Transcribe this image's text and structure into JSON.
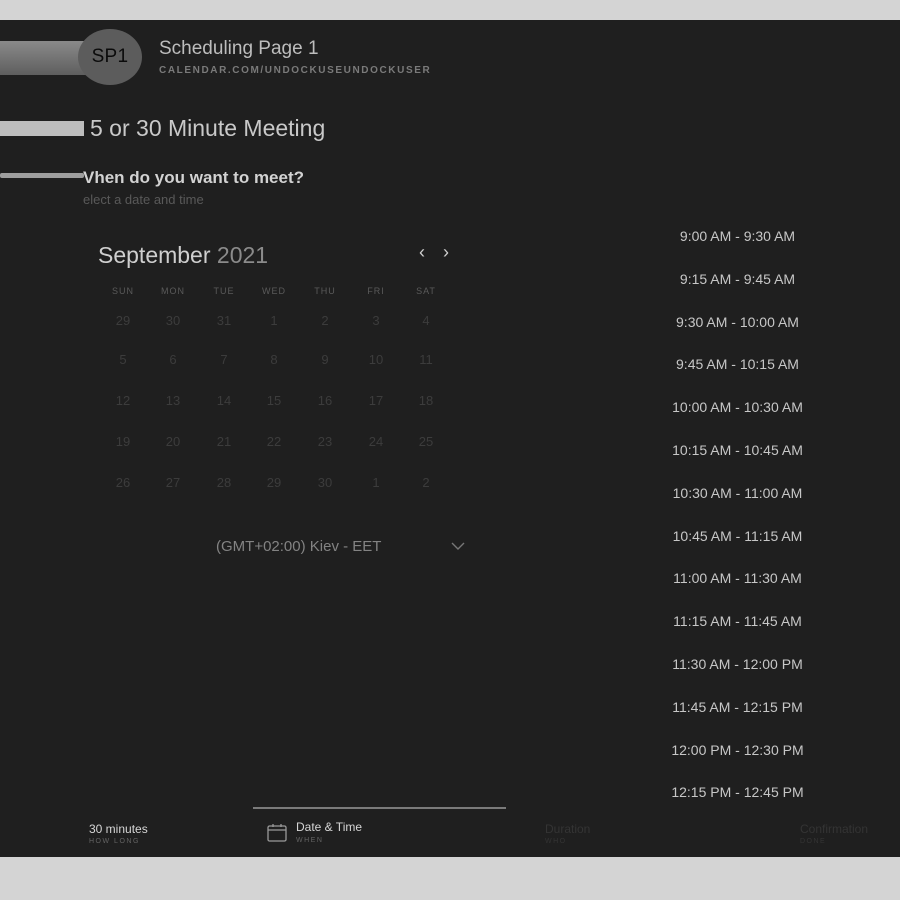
{
  "header": {
    "avatar_initials": "SP1",
    "page_name": "Scheduling Page 1",
    "page_url": "CALENDAR.COM/UNDOCKUSEUNDOCKUSER"
  },
  "meeting": {
    "title": "5 or 30 Minute Meeting",
    "question": "Vhen do you want to meet?",
    "subtitle": "elect a date and time"
  },
  "calendar": {
    "month": "September",
    "year": "2021",
    "prev_label": "‹",
    "next_label": "›",
    "weekdays": [
      "SUN",
      "MON",
      "TUE",
      "WED",
      "THU",
      "FRI",
      "SAT"
    ],
    "weeks": [
      [
        "29",
        "30",
        "31",
        "1",
        "2",
        "3",
        "4"
      ],
      [
        "5",
        "6",
        "7",
        "8",
        "9",
        "10",
        "11"
      ],
      [
        "12",
        "13",
        "14",
        "15",
        "16",
        "17",
        "18"
      ],
      [
        "19",
        "20",
        "21",
        "22",
        "23",
        "24",
        "25"
      ],
      [
        "26",
        "27",
        "28",
        "29",
        "30",
        "1",
        "2"
      ]
    ],
    "active_days": [
      "19",
      "7"
    ],
    "selected_day": "15"
  },
  "timezone": {
    "label": "(GMT+02:00) Kiev - EET"
  },
  "time_slots": [
    "9:00 AM - 9:30 AM",
    "9:15 AM - 9:45 AM",
    "9:30 AM - 10:00 AM",
    "9:45 AM - 10:15 AM",
    "10:00 AM - 10:30 AM",
    "10:15 AM - 10:45 AM",
    "10:30 AM - 11:00 AM",
    "10:45 AM - 11:15 AM",
    "11:00 AM - 11:30 AM",
    "11:15 AM - 11:45 AM",
    "11:30 AM - 12:00 PM",
    "11:45 AM - 12:15 PM",
    "12:00 PM - 12:30 PM",
    "12:15 PM - 12:45 PM"
  ],
  "footer": {
    "duration_label": "30 minutes",
    "duration_sub": "HOW LONG",
    "datetime_label": "Date & Time",
    "datetime_sub": "WHEN",
    "step3_label": "Duration",
    "step3_sub": "WHO",
    "step4_label": "Confirmation",
    "step4_sub": "DONE"
  },
  "colors": {
    "background": "#1f1f1f",
    "frame": "#d4d4d4",
    "selected_day": "#686868"
  }
}
